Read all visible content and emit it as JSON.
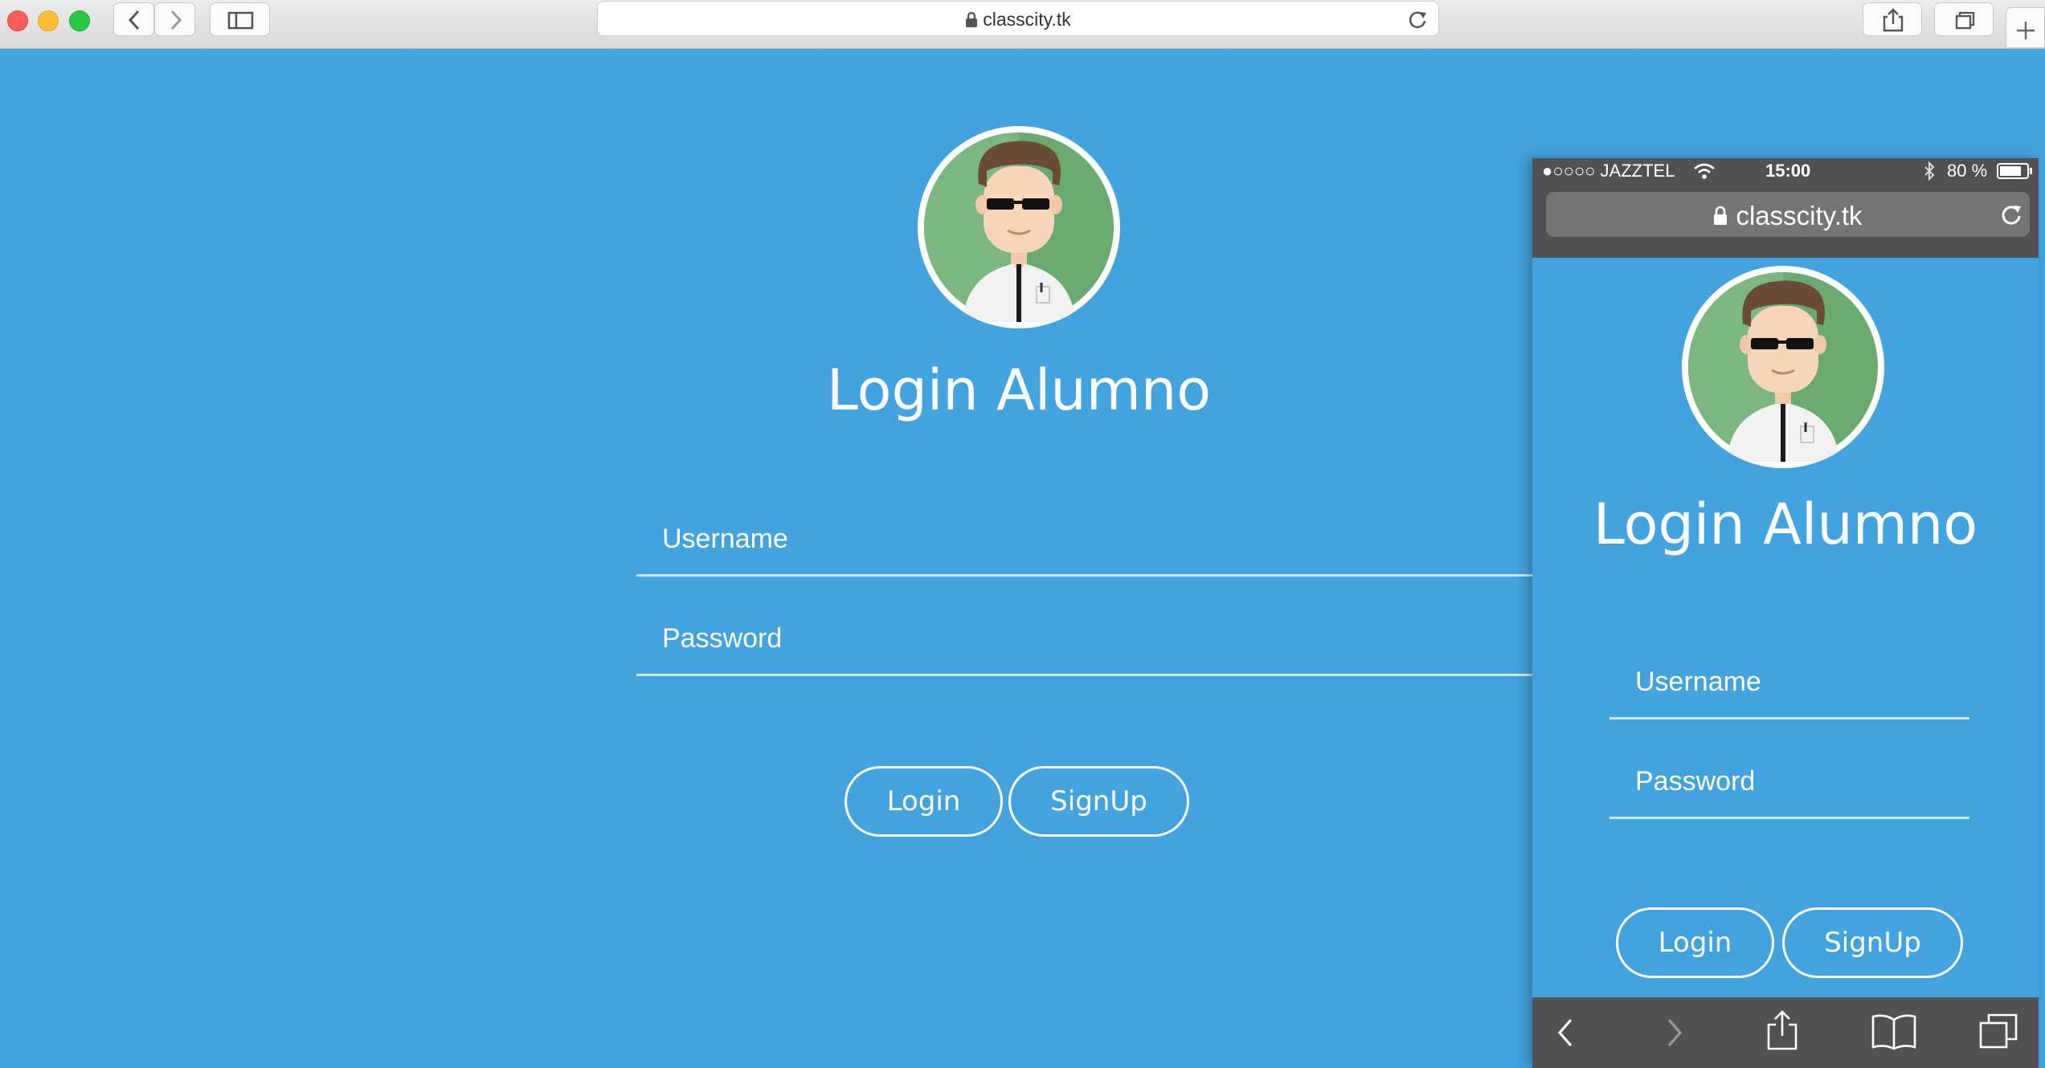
{
  "browser": {
    "url": "classcity.tk",
    "icons": [
      "back-icon",
      "forward-icon",
      "sidebar-icon",
      "lock-icon",
      "reload-icon",
      "share-icon",
      "tabs-icon",
      "new-tab-icon"
    ]
  },
  "login": {
    "title": "Login Alumno",
    "username_placeholder": "Username",
    "password_placeholder": "Password",
    "login_label": "Login",
    "signup_label": "SignUp"
  },
  "phone": {
    "carrier": "●○○○○ JAZZTEL",
    "time": "15:00",
    "battery": "80 %",
    "url": "classcity.tk",
    "title": "Login Alumno",
    "username_placeholder": "Username",
    "password_placeholder": "Password",
    "login_label": "Login",
    "signup_label": "SignUp"
  },
  "colors": {
    "page_background": "#42a3de",
    "avatar_green": "#6aaa6e",
    "phone_bar": "#515151"
  }
}
